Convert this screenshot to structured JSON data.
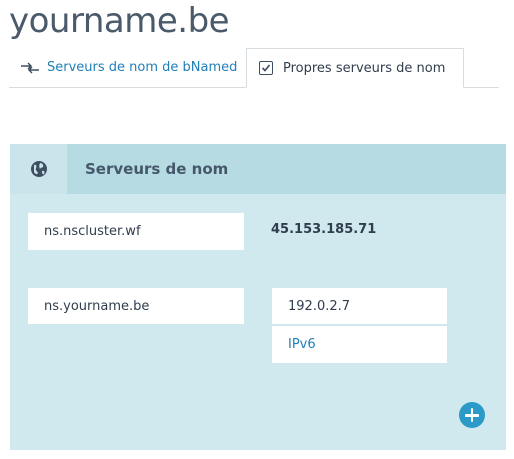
{
  "page": {
    "title": "yourname.be"
  },
  "tabs": {
    "bnamed_label": "Serveurs de nom de bNamed",
    "own_label": "Propres serveurs de nom",
    "own_checked": true,
    "bnamed_icon": "swap-arrows-icon",
    "own_icon": "checkbox-checked-icon"
  },
  "panel": {
    "title": "Serveurs de nom",
    "icon": "globe-icon",
    "nameservers": [
      {
        "hostname": "ns.nscluster.wf",
        "ip": "45.153.185.71"
      },
      {
        "hostname": "ns.yourname.be",
        "ipv4": "192.0.2.7",
        "ipv6_placeholder": "IPv6"
      }
    ],
    "add_icon": "plus-circle-icon"
  },
  "colors": {
    "link": "#1f7fb7",
    "panel_bg": "#cfe9ee",
    "panel_header_bg": "#b6dbe3",
    "add_button": "#2b9ac8"
  }
}
